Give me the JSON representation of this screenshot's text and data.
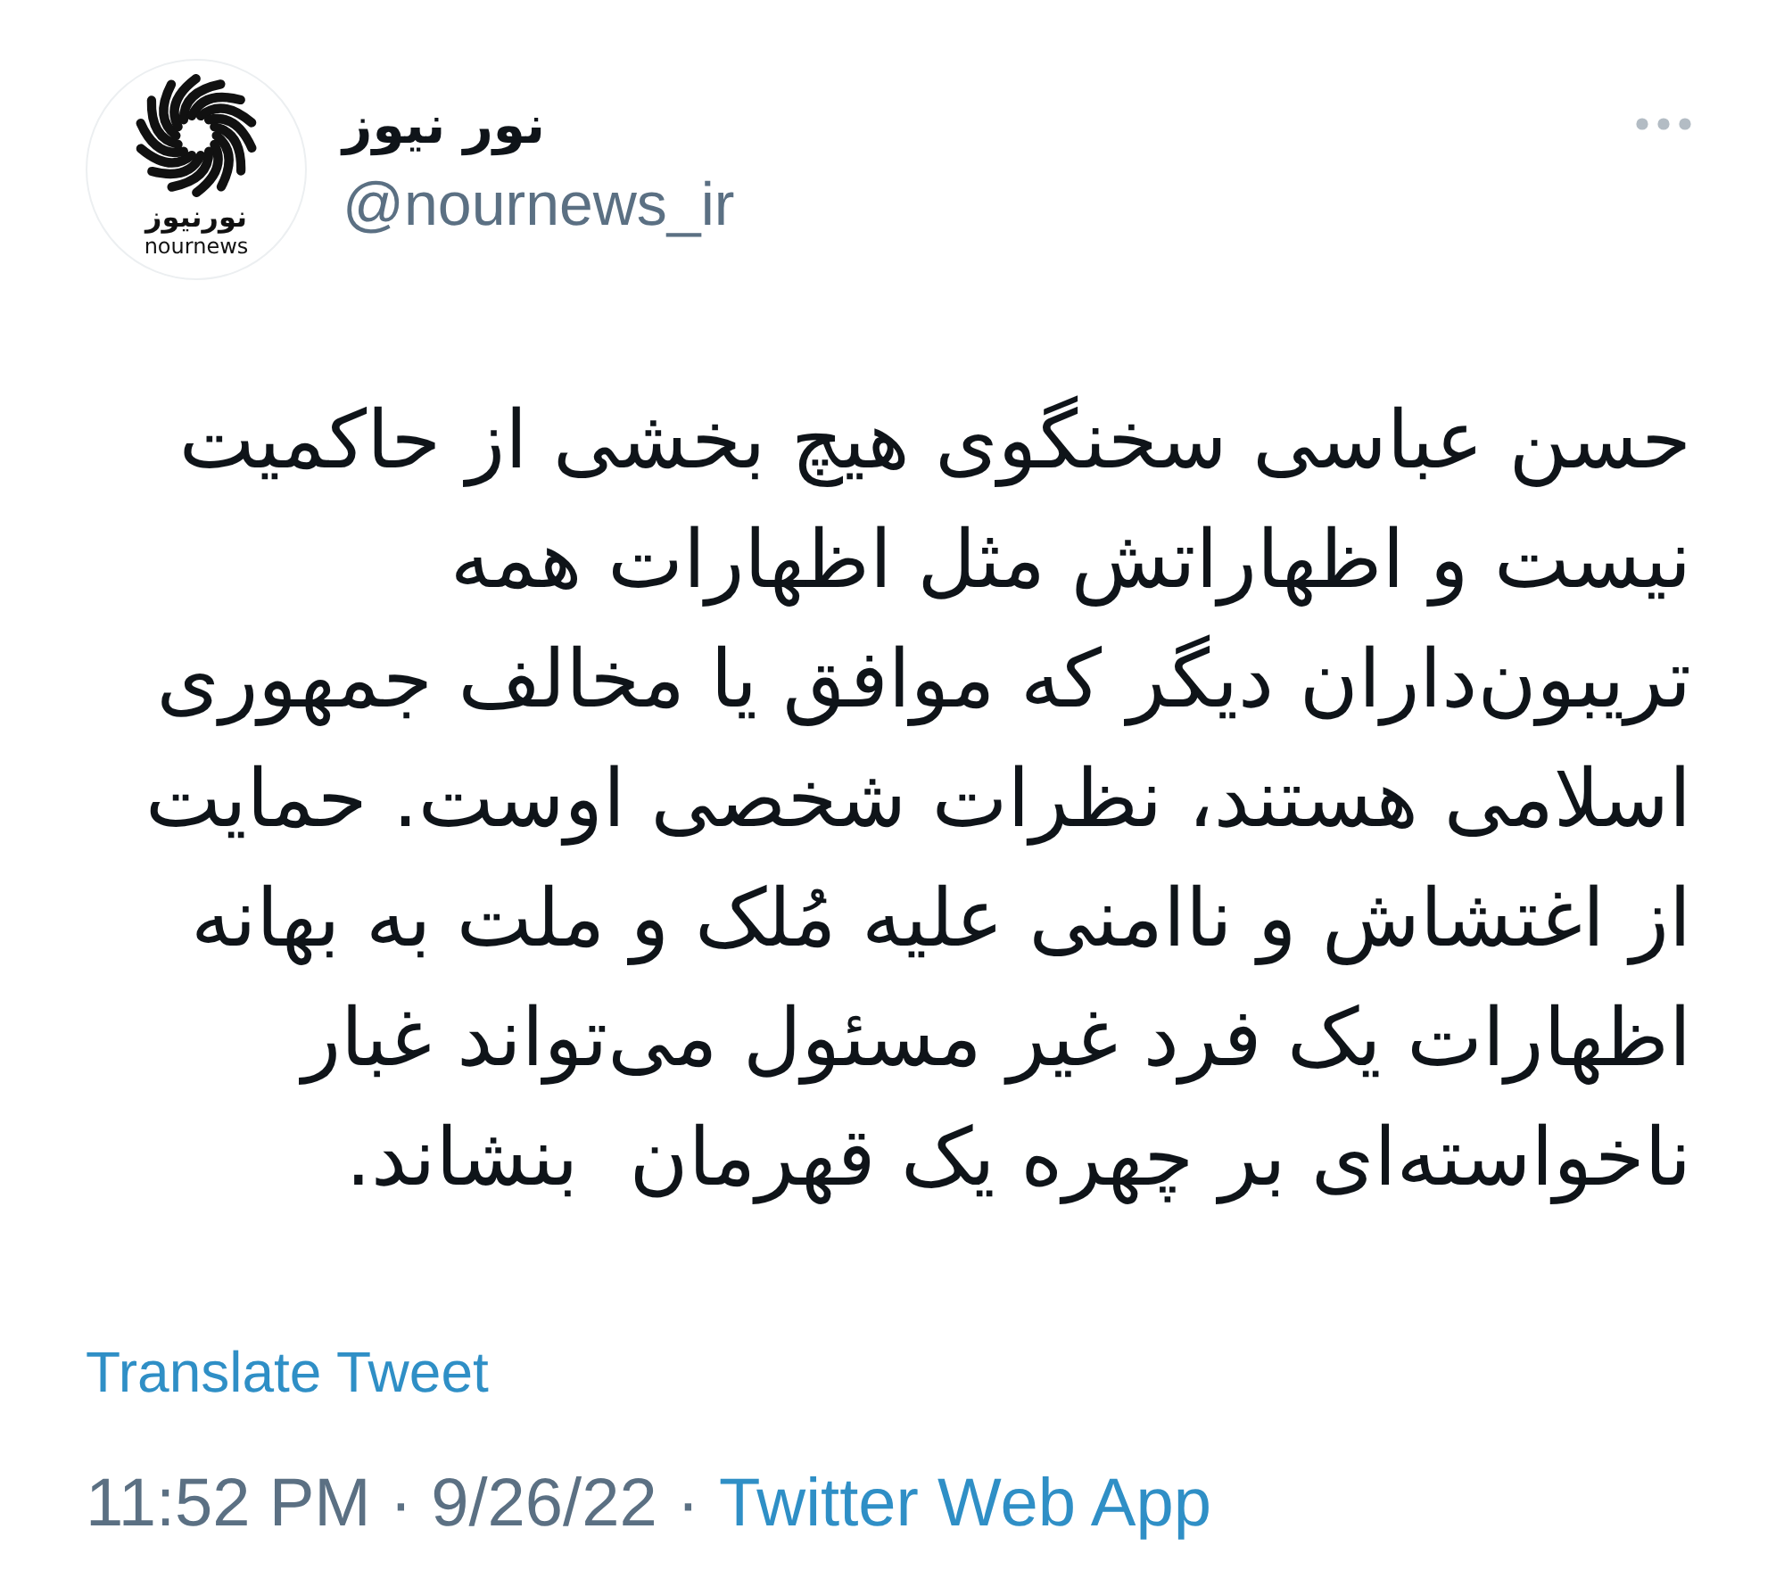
{
  "tweet": {
    "author": {
      "avatar": {
        "logo_text": "نورنیوز",
        "logo_caption": "nournews"
      },
      "name": "نور نیوز",
      "handle": "@nournews_ir"
    },
    "text": "حسن عباسی سخنگوی هیچ بخشی از حاکمیت\nنیست و اظهاراتش مثل اظهارات همه\nتریبون‌داران دیگر که موافق یا مخالف جمهوری\nاسلامی هستند، نظرات شخصی اوست. حمایت\nاز اغتشاش و ناامنی علیه مُلک و ملت به بهانه\nاظهارات یک فرد غیر مسئول می‌تواند غبار\nناخواسته‌ای بر چهره یک قهرمان  بنشاند.",
    "translate_link": "Translate Tweet",
    "timestamp": "11:52 PM · 9/26/22",
    "separator": "·",
    "source": "Twitter Web App"
  }
}
